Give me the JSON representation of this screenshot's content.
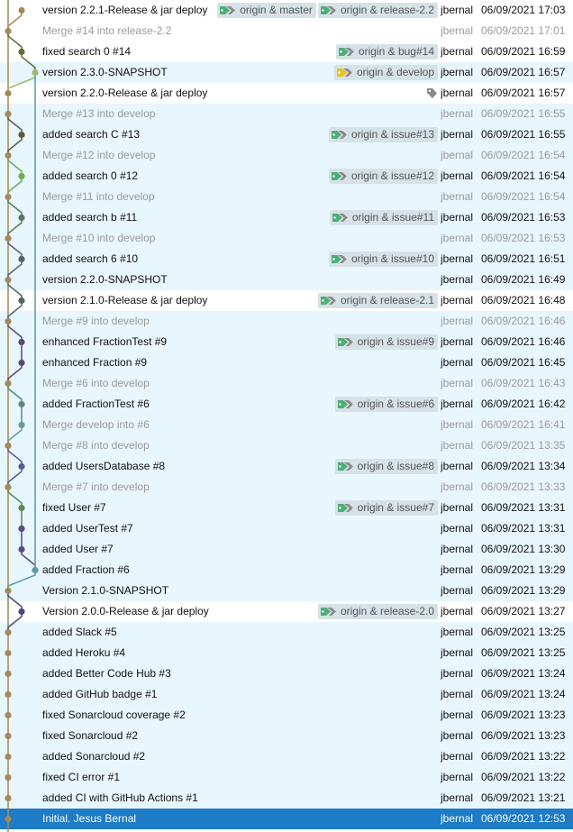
{
  "colors": {
    "row_alt": "#e8f6fd",
    "row_selected": "#1e7bc5",
    "ref_bg": "#d6e2e8",
    "tag_green": "#4caf76",
    "tag_yellow": "#e8c21a",
    "tag_gray": "#8a8a8a",
    "graph_main": "#a4895a",
    "graph_develop": "#5a9aa8"
  },
  "commits": [
    {
      "message": "version 2.2.1-Release & jar deploy",
      "author": "jbernal",
      "date": "06/09/2021 17:03",
      "refs": [
        {
          "label": "origin & master",
          "icon": "green-tag-icon"
        },
        {
          "label": "origin & release-2.2",
          "icon": "green-tag-icon"
        }
      ],
      "style": "white",
      "merge": false
    },
    {
      "message": "Merge #14 into release-2.2",
      "author": "jbernal",
      "date": "06/09/2021 17:01",
      "refs": [],
      "style": "white",
      "merge": true
    },
    {
      "message": "fixed search 0 #14",
      "author": "jbernal",
      "date": "06/09/2021 16:59",
      "refs": [
        {
          "label": "origin & bug#14",
          "icon": "green-tag-icon"
        }
      ],
      "style": "white",
      "merge": false
    },
    {
      "message": "version 2.3.0-SNAPSHOT",
      "author": "jbernal",
      "date": "06/09/2021 16:57",
      "refs": [
        {
          "label": "origin & develop",
          "icon": "yellow-tag-icon"
        }
      ],
      "style": "alt",
      "merge": false
    },
    {
      "message": "version 2.2.0-Release & jar deploy",
      "author": "jbernal",
      "date": "06/09/2021 16:57",
      "refs": [],
      "tag_only": true,
      "style": "white",
      "merge": false
    },
    {
      "message": "Merge #13 into develop",
      "author": "jbernal",
      "date": "06/09/2021 16:55",
      "refs": [],
      "style": "alt",
      "merge": true
    },
    {
      "message": "added search C #13",
      "author": "jbernal",
      "date": "06/09/2021 16:55",
      "refs": [
        {
          "label": "origin & issue#13",
          "icon": "green-tag-icon"
        }
      ],
      "style": "alt",
      "merge": false
    },
    {
      "message": "Merge #12 into develop",
      "author": "jbernal",
      "date": "06/09/2021 16:54",
      "refs": [],
      "style": "alt",
      "merge": true
    },
    {
      "message": "added search 0 #12",
      "author": "jbernal",
      "date": "06/09/2021 16:54",
      "refs": [
        {
          "label": "origin & issue#12",
          "icon": "green-tag-icon"
        }
      ],
      "style": "alt",
      "merge": false
    },
    {
      "message": "Merge #11 into develop",
      "author": "jbernal",
      "date": "06/09/2021 16:54",
      "refs": [],
      "style": "alt",
      "merge": true
    },
    {
      "message": "added search b #11",
      "author": "jbernal",
      "date": "06/09/2021 16:53",
      "refs": [
        {
          "label": "origin & issue#11",
          "icon": "green-tag-icon"
        }
      ],
      "style": "alt",
      "merge": false
    },
    {
      "message": "Merge #10 into develop",
      "author": "jbernal",
      "date": "06/09/2021 16:53",
      "refs": [],
      "style": "alt",
      "merge": true
    },
    {
      "message": "added search 6 #10",
      "author": "jbernal",
      "date": "06/09/2021 16:51",
      "refs": [
        {
          "label": "origin & issue#10",
          "icon": "green-tag-icon"
        }
      ],
      "style": "alt",
      "merge": false
    },
    {
      "message": "version 2.2.0-SNAPSHOT",
      "author": "jbernal",
      "date": "06/09/2021 16:49",
      "refs": [],
      "style": "alt",
      "merge": false
    },
    {
      "message": "version 2.1.0-Release & jar deploy",
      "author": "jbernal",
      "date": "06/09/2021 16:48",
      "refs": [
        {
          "label": "origin & release-2.1",
          "icon": "green-tag-icon"
        }
      ],
      "style": "white",
      "merge": false
    },
    {
      "message": "Merge #9 into develop",
      "author": "jbernal",
      "date": "06/09/2021 16:46",
      "refs": [],
      "style": "alt",
      "merge": true
    },
    {
      "message": "enhanced FractionTest #9",
      "author": "jbernal",
      "date": "06/09/2021 16:46",
      "refs": [
        {
          "label": "origin & issue#9",
          "icon": "green-tag-icon"
        }
      ],
      "style": "alt",
      "merge": false
    },
    {
      "message": "enhanced Fraction #9",
      "author": "jbernal",
      "date": "06/09/2021 16:45",
      "refs": [],
      "style": "alt",
      "merge": false
    },
    {
      "message": "Merge #6 into develop",
      "author": "jbernal",
      "date": "06/09/2021 16:43",
      "refs": [],
      "style": "alt",
      "merge": true
    },
    {
      "message": "added FractionTest #6",
      "author": "jbernal",
      "date": "06/09/2021 16:42",
      "refs": [
        {
          "label": "origin & issue#6",
          "icon": "green-tag-icon"
        }
      ],
      "style": "alt",
      "merge": false
    },
    {
      "message": "Merge develop into #6",
      "author": "jbernal",
      "date": "06/09/2021 16:41",
      "refs": [],
      "style": "alt",
      "merge": true
    },
    {
      "message": "Merge #8 into develop",
      "author": "jbernal",
      "date": "06/09/2021 13:35",
      "refs": [],
      "style": "alt",
      "merge": true
    },
    {
      "message": "added UsersDatabase #8",
      "author": "jbernal",
      "date": "06/09/2021 13:34",
      "refs": [
        {
          "label": "origin & issue#8",
          "icon": "green-tag-icon"
        }
      ],
      "style": "alt",
      "merge": false
    },
    {
      "message": "Merge #7 into develop",
      "author": "jbernal",
      "date": "06/09/2021 13:33",
      "refs": [],
      "style": "alt",
      "merge": true
    },
    {
      "message": "fixed User #7",
      "author": "jbernal",
      "date": "06/09/2021 13:31",
      "refs": [
        {
          "label": "origin & issue#7",
          "icon": "green-tag-icon"
        }
      ],
      "style": "alt",
      "merge": false
    },
    {
      "message": "added UserTest #7",
      "author": "jbernal",
      "date": "06/09/2021 13:31",
      "refs": [],
      "style": "alt",
      "merge": false
    },
    {
      "message": "added User #7",
      "author": "jbernal",
      "date": "06/09/2021 13:30",
      "refs": [],
      "style": "alt",
      "merge": false
    },
    {
      "message": "added Fraction #6",
      "author": "jbernal",
      "date": "06/09/2021 13:29",
      "refs": [],
      "style": "alt",
      "merge": false
    },
    {
      "message": "Version 2.1.0-SNAPSHOT",
      "author": "jbernal",
      "date": "06/09/2021 13:29",
      "refs": [],
      "style": "alt",
      "merge": false
    },
    {
      "message": "Version 2.0.0-Release & jar deploy",
      "author": "jbernal",
      "date": "06/09/2021 13:27",
      "refs": [
        {
          "label": "origin & release-2.0",
          "icon": "green-tag-icon"
        }
      ],
      "style": "white",
      "merge": false
    },
    {
      "message": "added Slack #5",
      "author": "jbernal",
      "date": "06/09/2021 13:25",
      "refs": [],
      "style": "alt",
      "merge": false
    },
    {
      "message": "added Heroku #4",
      "author": "jbernal",
      "date": "06/09/2021 13:25",
      "refs": [],
      "style": "alt",
      "merge": false
    },
    {
      "message": "added Better Code Hub #3",
      "author": "jbernal",
      "date": "06/09/2021 13:24",
      "refs": [],
      "style": "alt",
      "merge": false
    },
    {
      "message": "added GitHub badge #1",
      "author": "jbernal",
      "date": "06/09/2021 13:24",
      "refs": [],
      "style": "alt",
      "merge": false
    },
    {
      "message": "fixed Sonarcloud coverage #2",
      "author": "jbernal",
      "date": "06/09/2021 13:23",
      "refs": [],
      "style": "alt",
      "merge": false
    },
    {
      "message": "fixed Sonarcloud #2",
      "author": "jbernal",
      "date": "06/09/2021 13:23",
      "refs": [],
      "style": "alt",
      "merge": false
    },
    {
      "message": "added Sonarcloud #2",
      "author": "jbernal",
      "date": "06/09/2021 13:22",
      "refs": [],
      "style": "alt",
      "merge": false
    },
    {
      "message": "fixed CI error #1",
      "author": "jbernal",
      "date": "06/09/2021 13:22",
      "refs": [],
      "style": "alt",
      "merge": false
    },
    {
      "message": "added CI with GitHub Actions #1",
      "author": "jbernal",
      "date": "06/09/2021 13:21",
      "refs": [],
      "style": "alt",
      "merge": false
    },
    {
      "message": "Initial. Jesus Bernal",
      "author": "jbernal",
      "date": "06/09/2021 12:53",
      "refs": [],
      "style": "selected",
      "merge": false
    }
  ]
}
